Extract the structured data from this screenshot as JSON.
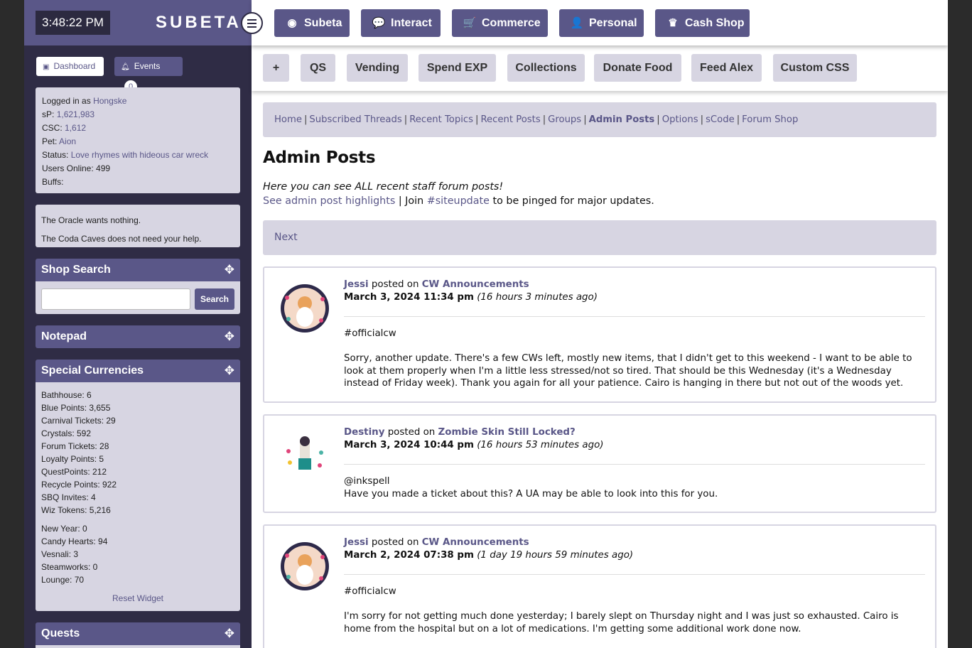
{
  "clock": "3:48:22 PM",
  "brand": "SUBETA",
  "nav": [
    {
      "label": "Subeta",
      "icon": "compass-icon",
      "glyph": "◉"
    },
    {
      "label": "Interact",
      "icon": "chat-bubbles-icon",
      "glyph": "💬"
    },
    {
      "label": "Commerce",
      "icon": "cart-icon",
      "glyph": "🛒"
    },
    {
      "label": "Personal",
      "icon": "user-icon",
      "glyph": "👤"
    },
    {
      "label": "Cash Shop",
      "icon": "crown-icon",
      "glyph": "♛"
    }
  ],
  "subnav": [
    "+",
    "QS",
    "Vending",
    "Spend EXP",
    "Collections",
    "Donate Food",
    "Feed Alex",
    "Custom CSS"
  ],
  "sidebar": {
    "dashboard_label": "Dashboard",
    "events_label": "Events",
    "events_count": "0",
    "user": {
      "logged_in_label": "Logged in as",
      "username": "Hongske",
      "sp_label": "sP:",
      "sp": "1,621,983",
      "csc_label": "CSC:",
      "csc": "1,612",
      "pet_label": "Pet:",
      "pet": "Aion",
      "status_label": "Status:",
      "status": "Love rhymes with hideous car wreck",
      "online_label": "Users Online:",
      "online": "499",
      "buffs_label": "Buffs:"
    },
    "oracle": "The Oracle wants nothing.",
    "coda": "The Coda Caves does not need your help.",
    "shop_search_title": "Shop Search",
    "search_button": "Search",
    "search_value": "",
    "notepad_title": "Notepad",
    "currencies_title": "Special Currencies",
    "currencies": [
      "Bathhouse: 6",
      "Blue Points: 3,655",
      "Carnival Tickets: 29",
      "Crystals: 592",
      "Forum Tickets: 28",
      "Loyalty Points: 5",
      "QuestPoints: 212",
      "Recycle Points: 922",
      "SBQ Invites: 4",
      "Wiz Tokens: 5,216"
    ],
    "event_currencies": [
      "New Year: 0",
      "Candy Hearts: 94",
      "Vesnali: 3",
      "Steamworks: 0",
      "Lounge: 70"
    ],
    "reset_widget": "Reset Widget",
    "quests_title": "Quests"
  },
  "breadcrumbs": [
    "Home",
    "Subscribed Threads",
    "Recent Topics",
    "Recent Posts",
    "Groups",
    "Admin Posts",
    "Options",
    "sCode",
    "Forum Shop"
  ],
  "page_title": "Admin Posts",
  "intro": "Here you can see ALL recent staff forum posts!",
  "intro_link": "See admin post highlights",
  "intro_sep": " | Join ",
  "intro_channel": "#siteupdate",
  "intro_tail": " to be pinged for major updates.",
  "next_label": "Next",
  "posted_on": "posted on",
  "posts": [
    {
      "user": "Jessi",
      "forum": "CW Announcements",
      "date": "March 3, 2024 11:34 pm",
      "ago": "(16 hours 3 minutes ago)",
      "body": [
        "#officialcw",
        "",
        "Sorry, another update. There's a few CWs left, mostly new items, that I didn't get to this weekend - I want to be able to look at them properly when I'm a little less stressed/not so tired. That should be this Wednesday (it's a Wednesday instead of Friday week). Thank you again for all your patience. Cairo is hanging in there but not out of the woods yet."
      ]
    },
    {
      "user": "Destiny",
      "forum": "Zombie Skin Still Locked?",
      "date": "March 3, 2024 10:44 pm",
      "ago": "(16 hours 53 minutes ago)",
      "body": [
        "@inkspell",
        "Have you made a ticket about this? A UA may be able to look into this for you."
      ]
    },
    {
      "user": "Jessi",
      "forum": "CW Announcements",
      "date": "March 2, 2024 07:38 pm",
      "ago": "(1 day 19 hours 59 minutes ago)",
      "body": [
        "#officialcw",
        "",
        "I'm sorry for not getting much done yesterday; I barely slept on Thursday night and I was just so exhausted. Cairo is home from the hospital but on a lot of medications. I'm getting some additional work done now."
      ]
    }
  ]
}
